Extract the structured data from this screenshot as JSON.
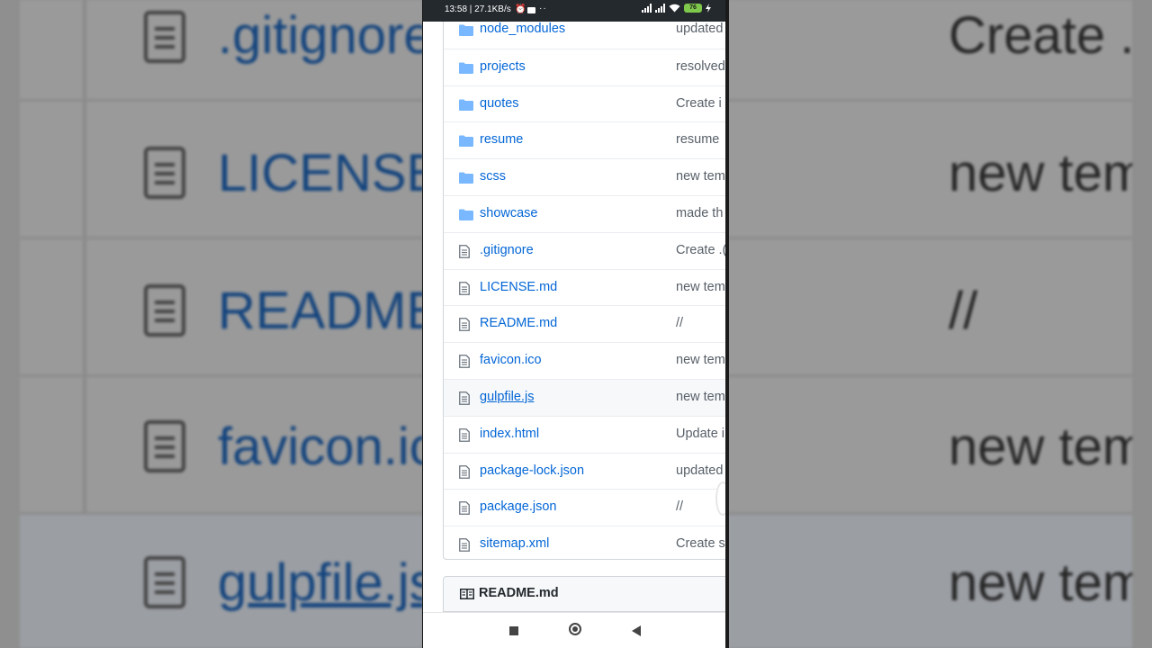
{
  "status_bar": {
    "time_speed": "13:58 | 27.1KB/s",
    "battery": "76"
  },
  "files": [
    {
      "name": "node_modules",
      "type": "folder",
      "message": "updated"
    },
    {
      "name": "projects",
      "type": "folder",
      "message": "resolved"
    },
    {
      "name": "quotes",
      "type": "folder",
      "message": "Create i"
    },
    {
      "name": "resume",
      "type": "folder",
      "message": "resume"
    },
    {
      "name": "scss",
      "type": "folder",
      "message": "new tem"
    },
    {
      "name": "showcase",
      "type": "folder",
      "message": "made th"
    },
    {
      "name": ".gitignore",
      "type": "file",
      "message": "Create .("
    },
    {
      "name": "LICENSE.md",
      "type": "file",
      "message": "new tem"
    },
    {
      "name": "README.md",
      "type": "file",
      "message": "//"
    },
    {
      "name": "favicon.ico",
      "type": "file",
      "message": "new tem"
    },
    {
      "name": "gulpfile.js",
      "type": "file",
      "message": "new tem"
    },
    {
      "name": "index.html",
      "type": "file",
      "message": "Update i"
    },
    {
      "name": "package-lock.json",
      "type": "file",
      "message": "updated"
    },
    {
      "name": "package.json",
      "type": "file",
      "message": "//"
    },
    {
      "name": "sitemap.xml",
      "type": "file",
      "message": "Create s"
    }
  ],
  "readme": {
    "title": "README.md"
  },
  "background": {
    "left_names": [
      ".gitignore",
      "LICENSE",
      "README",
      "favicon.ic",
      "gulpfile.js"
    ],
    "right_messages": [
      "Create .g",
      "new tem",
      "//",
      "new tem",
      "new tem"
    ]
  },
  "colors": {
    "link": "#0366d6",
    "status_bar": "#24292e",
    "folder": "#79b8ff"
  }
}
